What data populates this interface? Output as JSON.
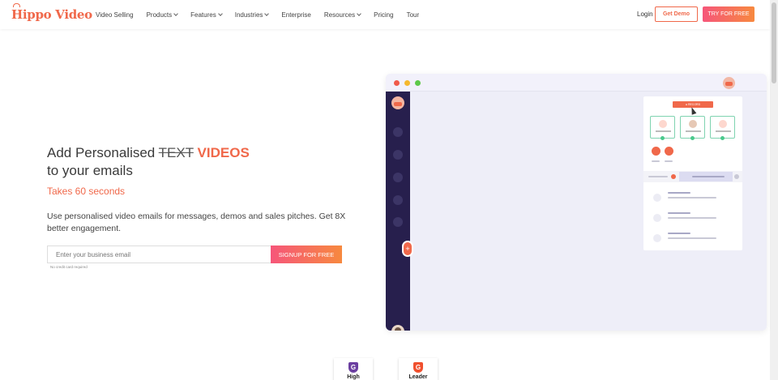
{
  "brand": {
    "name": "Hippo Video",
    "accent": "#f0684a",
    "gradient_start": "#f6567a",
    "gradient_end": "#f7893f",
    "sidebar_color": "#271f4d"
  },
  "nav": {
    "items": [
      {
        "label": "Video Selling",
        "dropdown": false
      },
      {
        "label": "Products",
        "dropdown": true
      },
      {
        "label": "Features",
        "dropdown": true
      },
      {
        "label": "Industries",
        "dropdown": true
      },
      {
        "label": "Enterprise",
        "dropdown": false
      },
      {
        "label": "Resources",
        "dropdown": true
      },
      {
        "label": "Pricing",
        "dropdown": false
      },
      {
        "label": "Tour",
        "dropdown": false
      }
    ],
    "login": "Login",
    "get_demo": "Get Demo",
    "try_free": "TRY FOR FREE"
  },
  "hero": {
    "title_prefix": "Add Personalised ",
    "title_strike": "TEXT",
    "title_accent": "VIDEOS",
    "title_line2": "to your emails",
    "subtitle": "Takes 60 seconds",
    "description": "Use personalised video emails for messages, demos and sales pitches. Get 8X better engagement.",
    "email_placeholder": "Enter your business email",
    "signup_label": "SIGNUP FOR FREE",
    "no_card": "No credit card required"
  },
  "mockup": {
    "record_label": "● RECORD",
    "plus": "+",
    "window_dots": [
      "#f05a4a",
      "#f5b82e",
      "#5ec94a"
    ]
  },
  "badges": [
    {
      "letter": "G",
      "color": "#6b3fa0",
      "text": "High"
    },
    {
      "letter": "G",
      "color": "#f0502e",
      "text": "Leader"
    }
  ]
}
